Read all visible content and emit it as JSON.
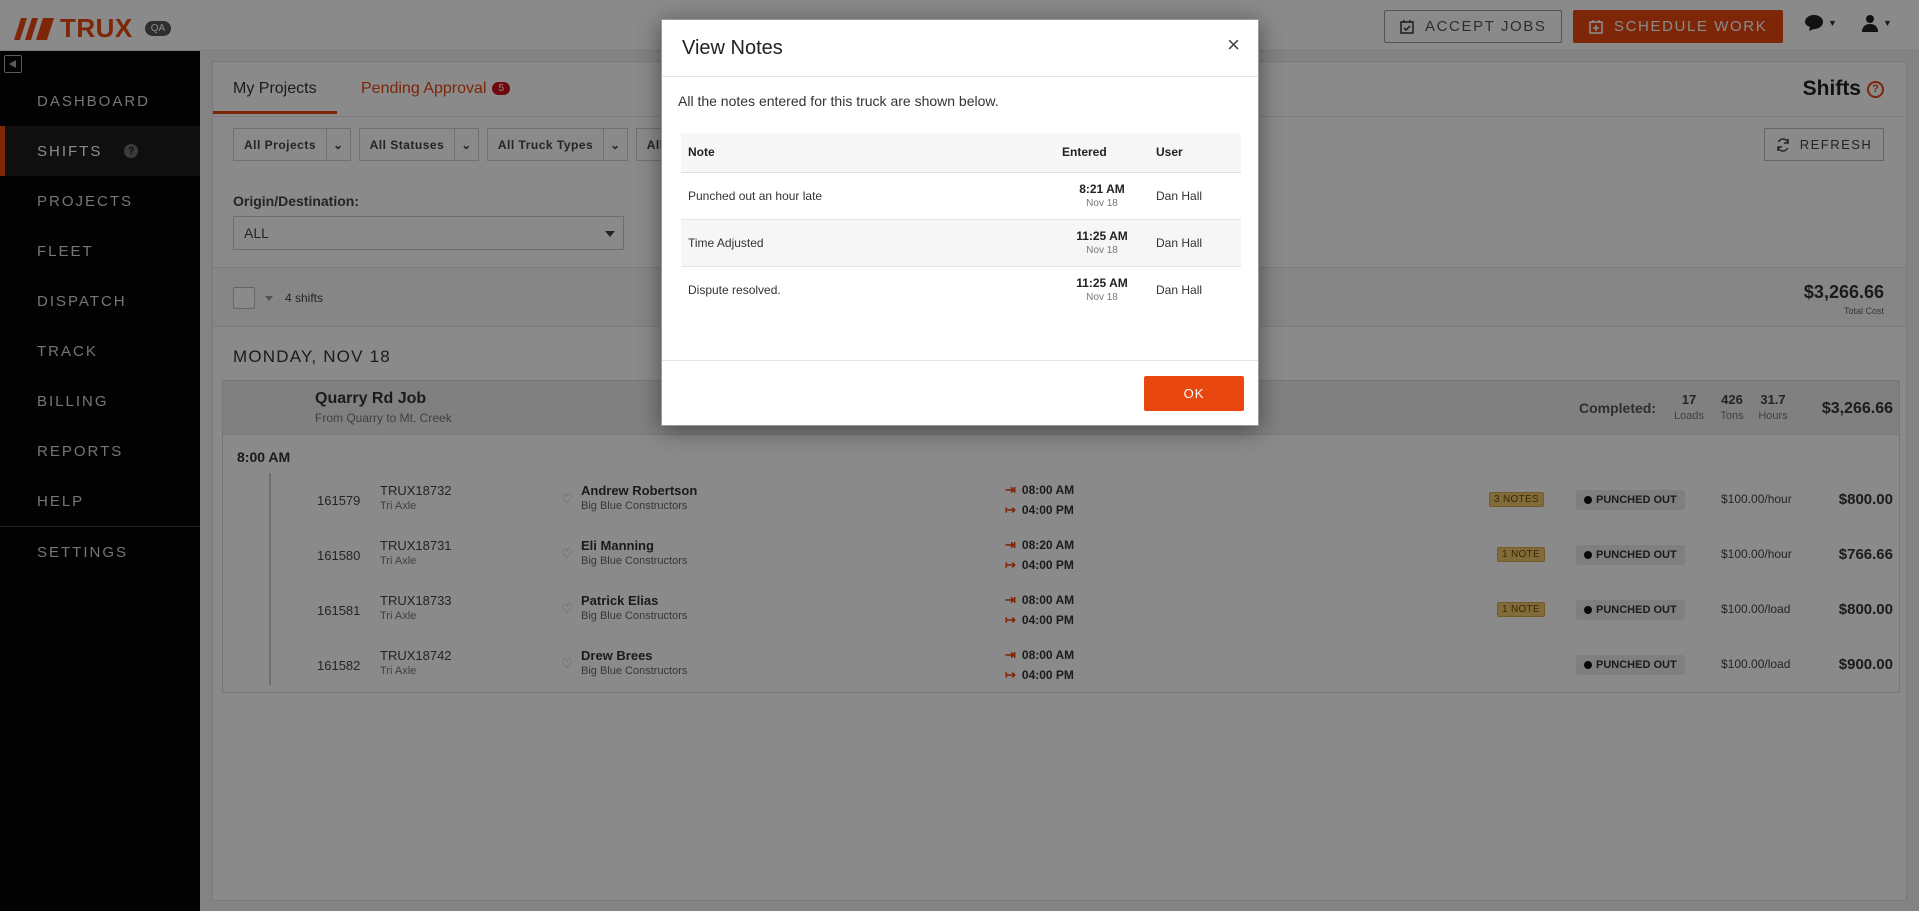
{
  "topbar": {
    "brand": "TRUX",
    "env": "QA",
    "accept_jobs": "ACCEPT JOBS",
    "schedule_work": "SCHEDULE WORK"
  },
  "sidebar": {
    "items": [
      {
        "label": "DASHBOARD"
      },
      {
        "label": "SHIFTS"
      },
      {
        "label": "PROJECTS"
      },
      {
        "label": "FLEET"
      },
      {
        "label": "DISPATCH"
      },
      {
        "label": "TRACK"
      },
      {
        "label": "BILLING"
      },
      {
        "label": "REPORTS"
      },
      {
        "label": "HELP"
      },
      {
        "label": "SETTINGS"
      }
    ],
    "shifts_help": "?"
  },
  "tabs": {
    "my_projects": "My Projects",
    "pending_approval": "Pending Approval",
    "pending_count": "5"
  },
  "page": {
    "title": "Shifts",
    "help": "?"
  },
  "filters": [
    "All Projects",
    "All Statuses",
    "All Truck Types",
    "All Dr"
  ],
  "refresh_label": "REFRESH",
  "origin_destination": {
    "label": "Origin/Destination:",
    "value": "ALL"
  },
  "summary": {
    "shift_count": "4 shifts",
    "total": "$3,266.66",
    "total_label": "Total Cost"
  },
  "day_heading": "MONDAY, NOV 18",
  "job": {
    "title": "Quarry Rd Job",
    "subtitle": "From Quarry to Mt. Creek",
    "completed_label": "Completed:",
    "stats": [
      {
        "value": "17",
        "label": "Loads"
      },
      {
        "value": "426",
        "label": "Tons"
      },
      {
        "value": "31.7",
        "label": "Hours"
      }
    ],
    "total": "$3,266.66",
    "time_group": "8:00 AM",
    "rows": [
      {
        "id": "161579",
        "truck": "TRUX18732",
        "type": "Tri Axle",
        "driver": "Andrew Robertson",
        "company": "Big Blue Constructors",
        "in": "08:00 AM",
        "out": "04:00 PM",
        "notes": "3 NOTES",
        "status": "PUNCHED OUT",
        "rate": "$100.00/hour",
        "amount": "$800.00"
      },
      {
        "id": "161580",
        "truck": "TRUX18731",
        "type": "Tri Axle",
        "driver": "Eli Manning",
        "company": "Big Blue Constructors",
        "in": "08:20 AM",
        "out": "04:00 PM",
        "notes": "1 NOTE",
        "status": "PUNCHED OUT",
        "rate": "$100.00/hour",
        "amount": "$766.66"
      },
      {
        "id": "161581",
        "truck": "TRUX18733",
        "type": "Tri Axle",
        "driver": "Patrick Elias",
        "company": "Big Blue Constructors",
        "in": "08:00 AM",
        "out": "04:00 PM",
        "notes": "1 NOTE",
        "status": "PUNCHED OUT",
        "rate": "$100.00/load",
        "amount": "$800.00"
      },
      {
        "id": "161582",
        "truck": "TRUX18742",
        "type": "Tri Axle",
        "driver": "Drew Brees",
        "company": "Big Blue Constructors",
        "in": "08:00 AM",
        "out": "04:00 PM",
        "notes": "",
        "status": "PUNCHED OUT",
        "rate": "$100.00/load",
        "amount": "$900.00"
      }
    ]
  },
  "modal": {
    "title": "View Notes",
    "close": "×",
    "description": "All the notes entered for this truck are shown below.",
    "columns": {
      "note": "Note",
      "entered": "Entered",
      "user": "User"
    },
    "notes": [
      {
        "note": "Punched out an hour late",
        "time": "8:21 AM",
        "date": "Nov 18",
        "user": "Dan Hall"
      },
      {
        "note": "Time Adjusted",
        "time": "11:25 AM",
        "date": "Nov 18",
        "user": "Dan Hall"
      },
      {
        "note": "Dispute resolved.",
        "time": "11:25 AM",
        "date": "Nov 18",
        "user": "Dan Hall"
      }
    ],
    "ok": "OK"
  },
  "colors": {
    "brand": "#e8470f",
    "sidebar": "#050505",
    "notes_badge": "#f0c66e",
    "pending_badge": "#d0121b"
  },
  "icons": [
    "trux-logo-icon",
    "calendar-check-icon",
    "calendar-plus-icon",
    "chat-icon",
    "user-icon",
    "collapse-icon",
    "refresh-icon",
    "heart-icon",
    "punch-in-icon",
    "punch-out-icon",
    "close-icon"
  ]
}
